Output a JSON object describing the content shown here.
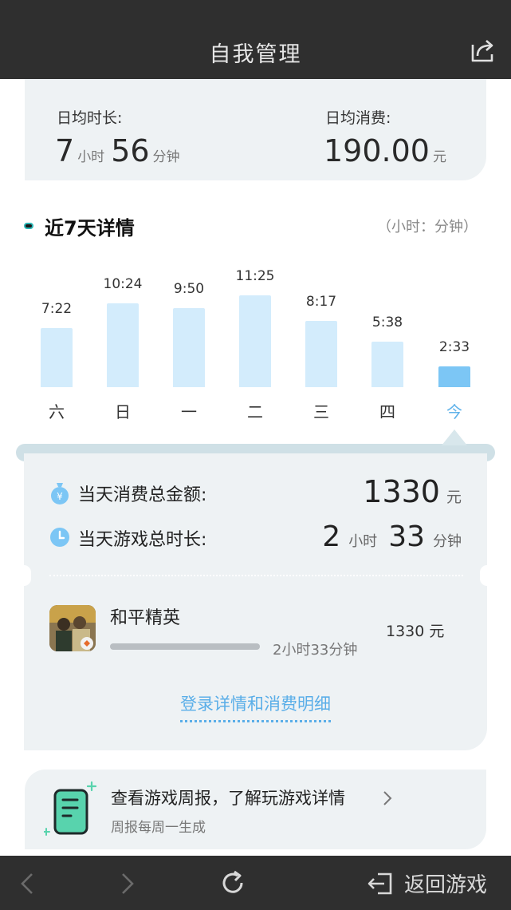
{
  "header": {
    "title": "自我管理",
    "share_icon": "share-icon"
  },
  "summary": {
    "avg_time_label": "日均时长:",
    "avg_time_hours": "7",
    "avg_time_hours_unit": "小时",
    "avg_time_minutes": "56",
    "avg_time_minutes_unit": "分钟",
    "avg_spend_label": "日均消费:",
    "avg_spend_value": "190.00",
    "avg_spend_unit": "元"
  },
  "section": {
    "title": "近7天详情",
    "unit_note": "（小时：分钟）"
  },
  "chart_data": {
    "type": "bar",
    "categories": [
      "六",
      "日",
      "一",
      "二",
      "三",
      "四",
      "今"
    ],
    "values": [
      "7:22",
      "10:24",
      "9:50",
      "11:25",
      "8:17",
      "5:38",
      "2:33"
    ],
    "highlight_index": 6
  },
  "detail": {
    "spend_label": "当天消费总金额:",
    "spend_value": "1330",
    "spend_unit": "元",
    "time_label": "当天游戏总时长:",
    "time_hours": "2",
    "time_hours_unit": "小时",
    "time_minutes": "33",
    "time_minutes_unit": "分钟",
    "game": {
      "name": "和平精英",
      "duration": "2小时33分钟",
      "amount": "1330 元"
    },
    "link": "登录详情和消费明细"
  },
  "weekly": {
    "title": "查看游戏周报，了解玩游戏详情",
    "subtitle": "周报每周一生成",
    "chevron": "chevron-right-icon"
  },
  "bottom": {
    "back_icon": "back-icon",
    "forward_icon": "forward-icon",
    "refresh_icon": "refresh-icon",
    "return_label": "返回游戏"
  },
  "colors": {
    "header_bg": "#2f2f2f",
    "card_bg": "#eef2f4",
    "bar": "#d3ecfc",
    "bar_today": "#7cc6f5",
    "accent": "#5aaee8"
  }
}
